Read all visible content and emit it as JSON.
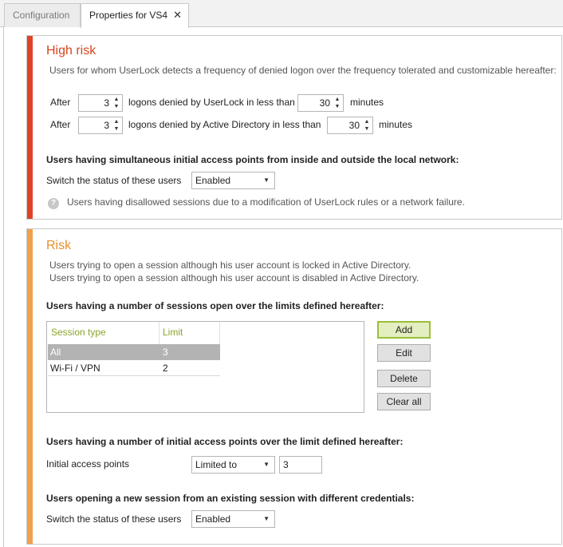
{
  "tabs": [
    {
      "label": "Configuration"
    },
    {
      "label": "Properties for VS4",
      "close": "✕"
    }
  ],
  "high_risk": {
    "title": "High risk",
    "description": "Users for whom UserLock detects a frequency of denied logon over the frequency tolerated and customizable hereafter:",
    "rules": [
      {
        "prefix": "After",
        "count": "3",
        "middle": "logons denied by UserLock in less than",
        "minutes": "30",
        "suffix": "minutes"
      },
      {
        "prefix": "After",
        "count": "3",
        "middle": "logons denied by Active Directory in less than",
        "minutes": "30",
        "suffix": "minutes"
      }
    ],
    "simultaneous_heading": "Users having simultaneous initial access points from inside and outside the local network:",
    "switch_label": "Switch the status of these users",
    "switch_value": "Enabled",
    "help_text": "Users having disallowed sessions due to a modification of UserLock rules or a network failure.",
    "help_icon": "?"
  },
  "risk": {
    "title": "Risk",
    "lines": [
      "Users trying to open a session although his user account is locked in Active Directory.",
      "Users trying to open a session although his user account is disabled in Active Directory."
    ],
    "sessions_heading": "Users having a number of sessions open over the limits defined hereafter:",
    "table": {
      "columns": [
        "Session type",
        "Limit"
      ],
      "rows": [
        {
          "type": "All",
          "limit": "3"
        },
        {
          "type": "Wi-Fi / VPN",
          "limit": "2"
        }
      ]
    },
    "buttons": {
      "add": "Add",
      "edit": "Edit",
      "delete": "Delete",
      "clear_all": "Clear all"
    },
    "access_heading": "Users having a number of initial access points over the limit defined hereafter:",
    "access_label": "Initial access points",
    "access_mode": "Limited to",
    "access_value": "3",
    "credentials_heading": "Users opening a new session from an existing session with different credentials:",
    "switch_label": "Switch the status of these users",
    "switch_value": "Enabled"
  },
  "colors": {
    "high_risk_accent": "#e14125",
    "risk_accent": "#f0a04c",
    "header_green": "#8aa52a"
  }
}
